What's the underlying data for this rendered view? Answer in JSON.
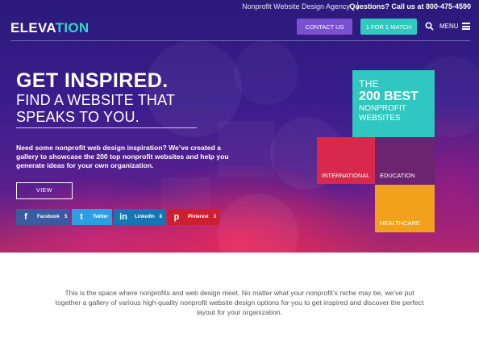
{
  "topbar": {
    "agency": "Nonprofit Website Design Agency",
    "phone": "Questions? Call us at 800-475-4590"
  },
  "header": {
    "logo_main": "ELEVA",
    "logo_accent": "TION",
    "contact_label": "CONTACT US",
    "match_label": "1 FOR 1 MATCH",
    "menu_label": "MENU",
    "search_icon": "search-icon",
    "menu_icon": "hamburger-icon"
  },
  "hero": {
    "heading": "GET INSPIRED.",
    "subheading": "FIND A WEBSITE THAT SPEAKS TO YOU.",
    "description": "Need some nonprofit web design inspiration? We’ve created a gallery to showcase the 200 top nonprofit websites and help you generate ideas for your own organization.",
    "view_label": "VIEW"
  },
  "share": [
    {
      "icon": "f",
      "label": "Facebook",
      "count": "5"
    },
    {
      "icon": "t",
      "label": "Twitter",
      "count": ""
    },
    {
      "icon": "in",
      "label": "LinkedIn",
      "count": "8"
    },
    {
      "icon": "p",
      "label": "Pinterest",
      "count": "3"
    }
  ],
  "tiles": {
    "main_line1": "THE",
    "main_line2": "200 BEST",
    "main_line3": "NONPROFIT",
    "main_line4": "WEBSITES",
    "international": "INTERNATIONAL",
    "education": "EDUCATION",
    "healthcare": "HEALTHCARE"
  },
  "colors": {
    "accent_teal": "#2fc7c0",
    "contact_purple": "#7a4fd0",
    "international_red": "#d8284b",
    "education_purple": "#6c2471",
    "healthcare_orange": "#f2a11d"
  },
  "intro": {
    "text": "This is the space where nonprofits and web design meet. No matter what your nonprofit’s niche may be, we’ve put together a gallery of various high-quality nonprofit website design options for you to get inspired and discover the perfect layout for your organization."
  }
}
